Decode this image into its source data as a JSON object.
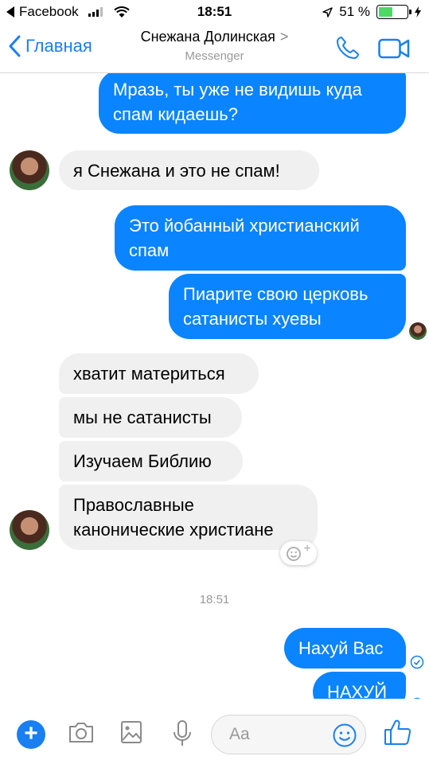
{
  "status_bar": {
    "back_app": "Facebook",
    "time": "18:51",
    "battery_percent": "51 %",
    "battery_level": 0.51
  },
  "header": {
    "back_label": "Главная",
    "contact_name": "Снежана Долинская",
    "chevron": ">",
    "subtitle": "Messenger",
    "icons": [
      "phone-icon",
      "video-camera-icon"
    ]
  },
  "messages": [
    {
      "side": "out",
      "lines": [
        "Мразь, ты уже не видишь куда",
        "спам кидаешь?"
      ]
    },
    {
      "side": "in",
      "lines": [
        "я Снежана и это не спам!"
      ]
    },
    {
      "side": "out",
      "lines": [
        "Это йобанный христианский",
        "спам"
      ]
    },
    {
      "side": "out",
      "lines": [
        "Пиарите свою церковь",
        "сатанисты хуевы"
      ]
    },
    {
      "side": "in",
      "lines": [
        "хватит материться"
      ]
    },
    {
      "side": "in",
      "lines": [
        "мы не сатанисты"
      ]
    },
    {
      "side": "in",
      "lines": [
        "Изучаем Библию"
      ]
    },
    {
      "side": "in",
      "lines": [
        "Православные",
        "канонические христиане"
      ]
    },
    {
      "side": "out",
      "lines": [
        "Нахуй Вас"
      ]
    },
    {
      "side": "out",
      "lines": [
        "НАХУЙ"
      ]
    }
  ],
  "timestamp": "18:51",
  "react_button": {
    "icon": "add-reaction-icon",
    "plus": "+"
  },
  "composer": {
    "placeholder": "Aa",
    "icons": [
      "plus-icon",
      "camera-icon",
      "image-icon",
      "microphone-icon",
      "emoji-icon",
      "thumbs-up-icon"
    ],
    "plus": "+"
  },
  "colors": {
    "accent": "#1a7ff0",
    "outgoing_bubble": "#0a84ff",
    "incoming_bubble": "#f0f0f0",
    "battery": "#4cd964"
  }
}
